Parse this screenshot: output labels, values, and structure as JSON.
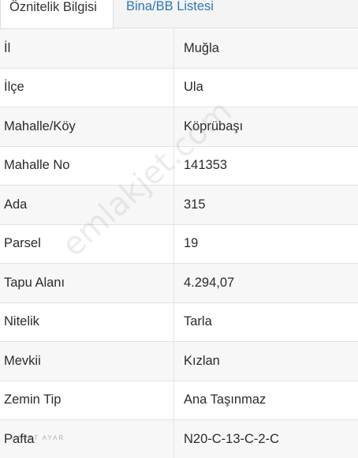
{
  "tabs": [
    {
      "label": "Öznitelik Bilgisi",
      "active": true
    },
    {
      "label": "Bina/BB Listesi",
      "active": false
    }
  ],
  "rows": [
    {
      "key": "İl",
      "value": "Muğla"
    },
    {
      "key": "İlçe",
      "value": "Ula"
    },
    {
      "key": "Mahalle/Köy",
      "value": "Köprübaşı"
    },
    {
      "key": "Mahalle No",
      "value": "141353"
    },
    {
      "key": "Ada",
      "value": "315"
    },
    {
      "key": "Parsel",
      "value": "19"
    },
    {
      "key": "Tapu Alanı",
      "value": "4.294,07"
    },
    {
      "key": "Nitelik",
      "value": "Tarla"
    },
    {
      "key": "Mevkii",
      "value": "Kızlan"
    },
    {
      "key": "Zemin Tip",
      "value": "Ana Taşınmaz"
    },
    {
      "key": "Pafta",
      "value": "N20-C-13-C-2-C"
    }
  ],
  "watermark": "emlakjet.com",
  "footer_mark": "AHMET AYAR",
  "colors": {
    "tab_link": "#2f76b5",
    "row_odd": "#f7f7f7",
    "row_even": "#ffffff",
    "border": "#e3e3e3"
  }
}
